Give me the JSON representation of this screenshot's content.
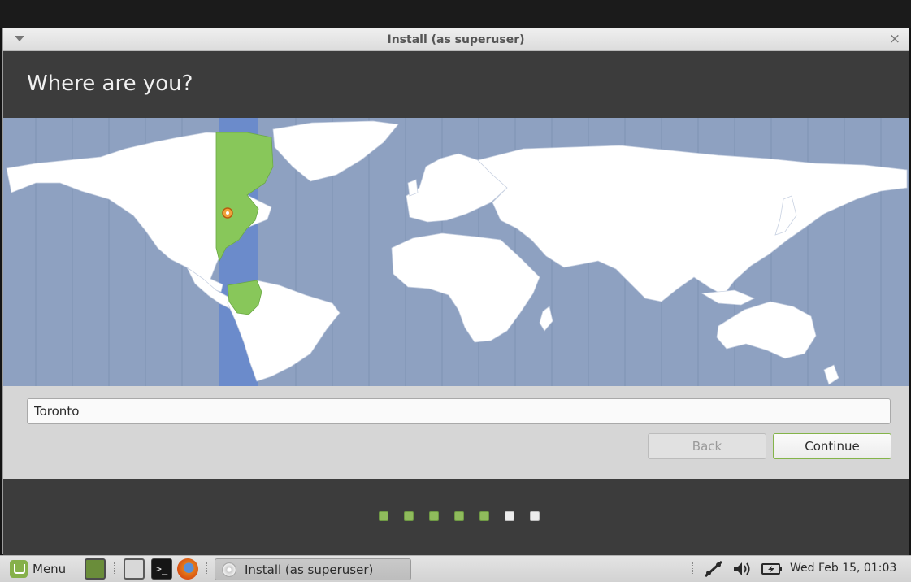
{
  "window": {
    "title": "Install (as superuser)",
    "close_glyph": "×",
    "menu_icon": "window-menu-icon"
  },
  "page": {
    "heading": "Where are you?"
  },
  "timezone": {
    "value": "Toronto",
    "selected_marker_icon": "location-pin-icon"
  },
  "buttons": {
    "back": "Back",
    "continue": "Continue"
  },
  "progress": {
    "total_steps": 7,
    "completed_steps": 5
  },
  "taskbar": {
    "menu_label": "Menu",
    "window_button_label": "Install (as superuser)",
    "terminal_glyph": ">_",
    "clock": "Wed Feb 15, 01:03"
  },
  "colors": {
    "ocean": "#8ea1c1",
    "land": "#ffffff",
    "selected_zone_band": "#6b8bcb",
    "selected_zone_land": "#88c75a",
    "accent_green": "#84b44a",
    "header_dark": "#3c3c3c"
  }
}
